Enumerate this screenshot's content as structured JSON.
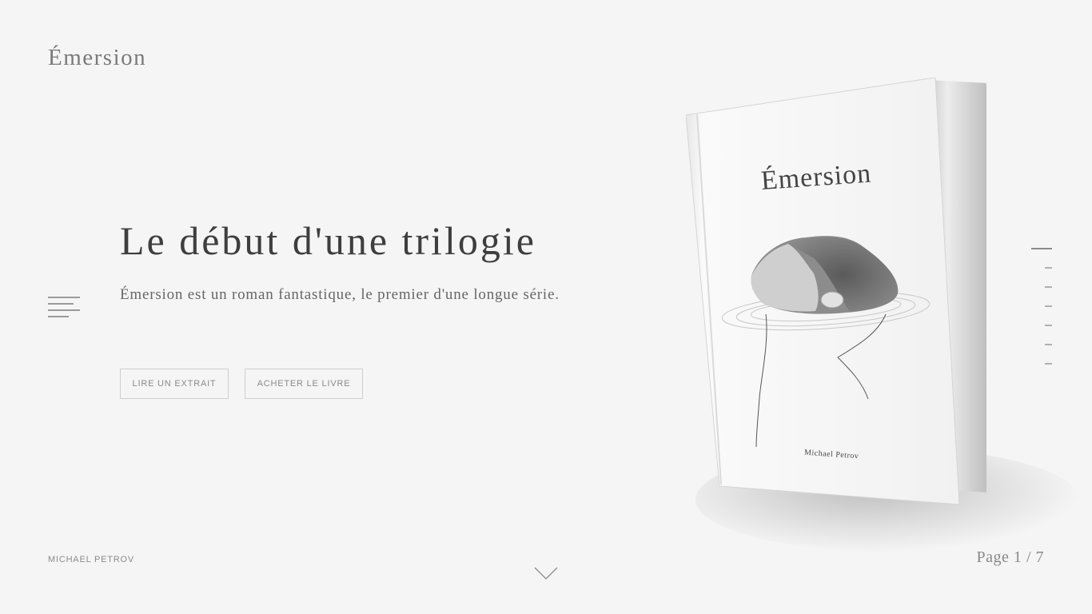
{
  "brand": {
    "logo": "Émersion"
  },
  "hero": {
    "title": "Le début d'une trilogie",
    "description": "Émersion est un roman fantastique, le premier d'une longue série.",
    "buttons": {
      "excerpt": "LIRE UN EXTRAIT",
      "buy": "ACHETER LE LIVRE"
    }
  },
  "book": {
    "title": "Émersion",
    "author": "Michael Petrov"
  },
  "footer": {
    "author": "MICHAEL PETROV",
    "page_label": "Page 1",
    "page_total": "/ 7"
  },
  "navigation": {
    "menu_icon": "hamburger-menu-icon",
    "scroll_icon": "chevron-down-icon",
    "slide_count": 7,
    "active_slide": 1
  },
  "colors": {
    "background": "#f5f5f5",
    "text_dark": "#3e3e3e",
    "text_muted": "#8a8a8a"
  }
}
